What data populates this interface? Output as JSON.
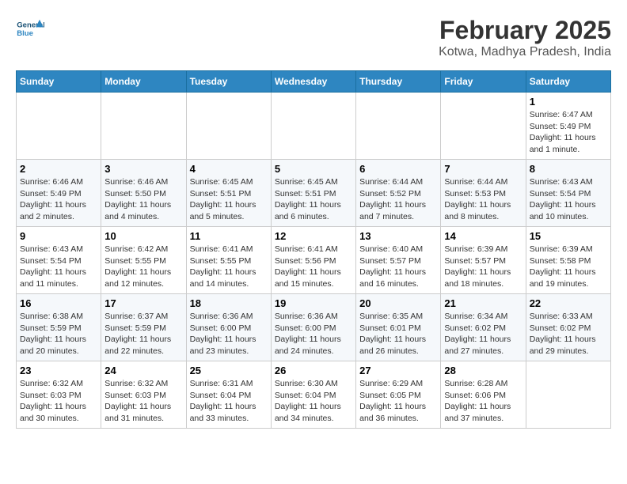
{
  "header": {
    "logo_line1": "General",
    "logo_line2": "Blue",
    "title": "February 2025",
    "subtitle": "Kotwa, Madhya Pradesh, India"
  },
  "calendar": {
    "headers": [
      "Sunday",
      "Monday",
      "Tuesday",
      "Wednesday",
      "Thursday",
      "Friday",
      "Saturday"
    ],
    "weeks": [
      [
        {
          "day": "",
          "info": ""
        },
        {
          "day": "",
          "info": ""
        },
        {
          "day": "",
          "info": ""
        },
        {
          "day": "",
          "info": ""
        },
        {
          "day": "",
          "info": ""
        },
        {
          "day": "",
          "info": ""
        },
        {
          "day": "1",
          "info": "Sunrise: 6:47 AM\nSunset: 5:49 PM\nDaylight: 11 hours and 1 minute."
        }
      ],
      [
        {
          "day": "2",
          "info": "Sunrise: 6:46 AM\nSunset: 5:49 PM\nDaylight: 11 hours and 2 minutes."
        },
        {
          "day": "3",
          "info": "Sunrise: 6:46 AM\nSunset: 5:50 PM\nDaylight: 11 hours and 4 minutes."
        },
        {
          "day": "4",
          "info": "Sunrise: 6:45 AM\nSunset: 5:51 PM\nDaylight: 11 hours and 5 minutes."
        },
        {
          "day": "5",
          "info": "Sunrise: 6:45 AM\nSunset: 5:51 PM\nDaylight: 11 hours and 6 minutes."
        },
        {
          "day": "6",
          "info": "Sunrise: 6:44 AM\nSunset: 5:52 PM\nDaylight: 11 hours and 7 minutes."
        },
        {
          "day": "7",
          "info": "Sunrise: 6:44 AM\nSunset: 5:53 PM\nDaylight: 11 hours and 8 minutes."
        },
        {
          "day": "8",
          "info": "Sunrise: 6:43 AM\nSunset: 5:54 PM\nDaylight: 11 hours and 10 minutes."
        }
      ],
      [
        {
          "day": "9",
          "info": "Sunrise: 6:43 AM\nSunset: 5:54 PM\nDaylight: 11 hours and 11 minutes."
        },
        {
          "day": "10",
          "info": "Sunrise: 6:42 AM\nSunset: 5:55 PM\nDaylight: 11 hours and 12 minutes."
        },
        {
          "day": "11",
          "info": "Sunrise: 6:41 AM\nSunset: 5:55 PM\nDaylight: 11 hours and 14 minutes."
        },
        {
          "day": "12",
          "info": "Sunrise: 6:41 AM\nSunset: 5:56 PM\nDaylight: 11 hours and 15 minutes."
        },
        {
          "day": "13",
          "info": "Sunrise: 6:40 AM\nSunset: 5:57 PM\nDaylight: 11 hours and 16 minutes."
        },
        {
          "day": "14",
          "info": "Sunrise: 6:39 AM\nSunset: 5:57 PM\nDaylight: 11 hours and 18 minutes."
        },
        {
          "day": "15",
          "info": "Sunrise: 6:39 AM\nSunset: 5:58 PM\nDaylight: 11 hours and 19 minutes."
        }
      ],
      [
        {
          "day": "16",
          "info": "Sunrise: 6:38 AM\nSunset: 5:59 PM\nDaylight: 11 hours and 20 minutes."
        },
        {
          "day": "17",
          "info": "Sunrise: 6:37 AM\nSunset: 5:59 PM\nDaylight: 11 hours and 22 minutes."
        },
        {
          "day": "18",
          "info": "Sunrise: 6:36 AM\nSunset: 6:00 PM\nDaylight: 11 hours and 23 minutes."
        },
        {
          "day": "19",
          "info": "Sunrise: 6:36 AM\nSunset: 6:00 PM\nDaylight: 11 hours and 24 minutes."
        },
        {
          "day": "20",
          "info": "Sunrise: 6:35 AM\nSunset: 6:01 PM\nDaylight: 11 hours and 26 minutes."
        },
        {
          "day": "21",
          "info": "Sunrise: 6:34 AM\nSunset: 6:02 PM\nDaylight: 11 hours and 27 minutes."
        },
        {
          "day": "22",
          "info": "Sunrise: 6:33 AM\nSunset: 6:02 PM\nDaylight: 11 hours and 29 minutes."
        }
      ],
      [
        {
          "day": "23",
          "info": "Sunrise: 6:32 AM\nSunset: 6:03 PM\nDaylight: 11 hours and 30 minutes."
        },
        {
          "day": "24",
          "info": "Sunrise: 6:32 AM\nSunset: 6:03 PM\nDaylight: 11 hours and 31 minutes."
        },
        {
          "day": "25",
          "info": "Sunrise: 6:31 AM\nSunset: 6:04 PM\nDaylight: 11 hours and 33 minutes."
        },
        {
          "day": "26",
          "info": "Sunrise: 6:30 AM\nSunset: 6:04 PM\nDaylight: 11 hours and 34 minutes."
        },
        {
          "day": "27",
          "info": "Sunrise: 6:29 AM\nSunset: 6:05 PM\nDaylight: 11 hours and 36 minutes."
        },
        {
          "day": "28",
          "info": "Sunrise: 6:28 AM\nSunset: 6:06 PM\nDaylight: 11 hours and 37 minutes."
        },
        {
          "day": "",
          "info": ""
        }
      ]
    ]
  }
}
